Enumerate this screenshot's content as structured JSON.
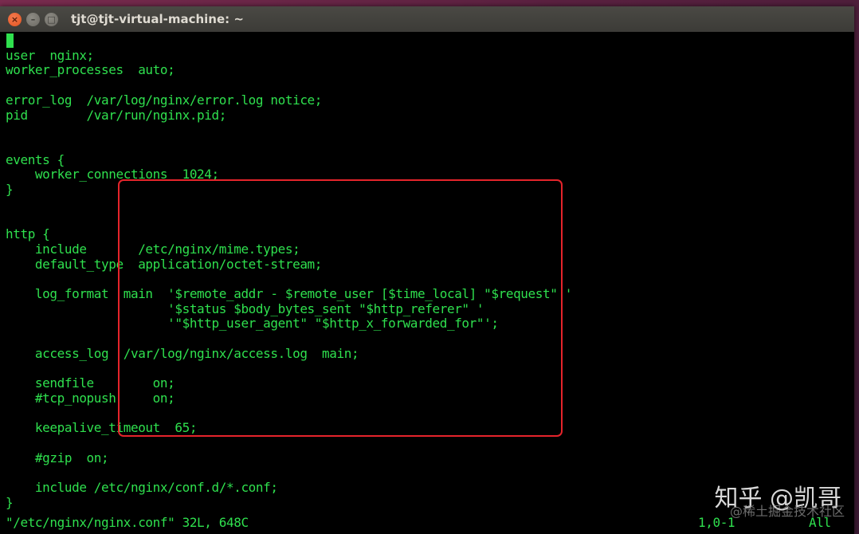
{
  "window": {
    "title": "tjt@tjt-virtual-machine: ~"
  },
  "editor": {
    "lines": [
      "",
      "user  nginx;",
      "worker_processes  auto;",
      "",
      "error_log  /var/log/nginx/error.log notice;",
      "pid        /var/run/nginx.pid;",
      "",
      "",
      "events {",
      "    worker_connections  1024;",
      "}",
      "",
      "",
      "http {",
      "    include       /etc/nginx/mime.types;",
      "    default_type  application/octet-stream;",
      "",
      "    log_format  main  '$remote_addr - $remote_user [$time_local] \"$request\" '",
      "                      '$status $body_bytes_sent \"$http_referer\" '",
      "                      '\"$http_user_agent\" \"$http_x_forwarded_for\"';",
      "",
      "    access_log  /var/log/nginx/access.log  main;",
      "",
      "    sendfile        on;",
      "    #tcp_nopush     on;",
      "",
      "    keepalive_timeout  65;",
      "",
      "    #gzip  on;",
      "",
      "    include /etc/nginx/conf.d/*.conf;",
      "}"
    ],
    "status_file": "\"/etc/nginx/nginx.conf\" 32L, 648C",
    "status_position": "1,0-1",
    "status_scroll": "All",
    "colors": {
      "text": "#2fe04e",
      "background": "#000000",
      "highlight_box": "#e5242b"
    }
  },
  "watermark": {
    "brand": "知乎 @凯哥",
    "sub": "@稀土掘金技术社区"
  }
}
